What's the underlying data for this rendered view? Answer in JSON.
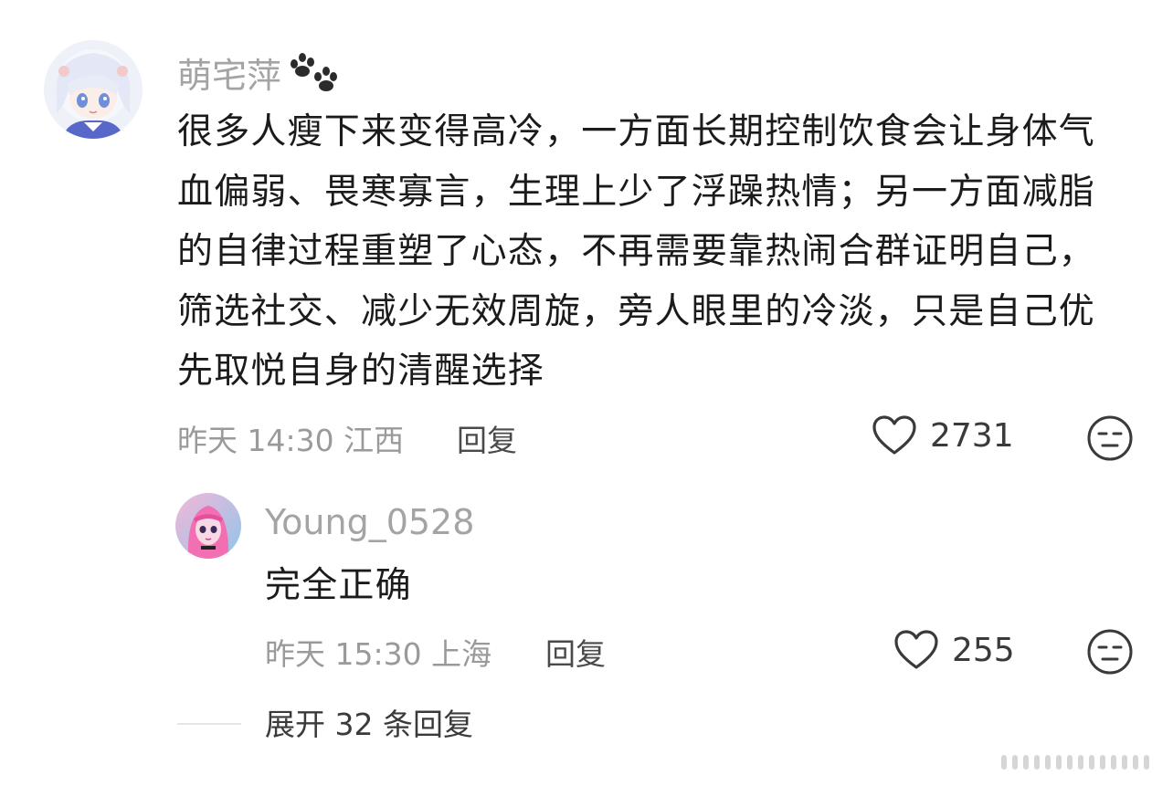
{
  "comment": {
    "username": "萌宅萍",
    "username_badge_icon": "paw-prints-icon",
    "lines": [
      "很多人瘦下来变得高冷，一方面长期控制饮食会让身体气",
      "血偏弱、畏寒寡言，生理上少了浮躁热情；另一方面减脂",
      "的自律过程重塑了心态，不再需要靠热闹合群证明自己，",
      "筛选社交、减少无效周旋，旁人眼里的冷淡，只是自己优",
      "先取悦自身的清醒选择"
    ],
    "meta": "昨天 14:30 江西",
    "reply_label": "回复",
    "like_count": "2731"
  },
  "reply": {
    "username": "Young_0528",
    "text": "完全正确",
    "meta": "昨天 15:30 上海",
    "reply_label": "回复",
    "like_count": "255"
  },
  "expand_label": "展开 32 条回复",
  "colors": {
    "text": "#1b1b1b",
    "muted": "#9a9a9a",
    "username": "#a4a4a4",
    "icon": "#3a3a3a"
  }
}
